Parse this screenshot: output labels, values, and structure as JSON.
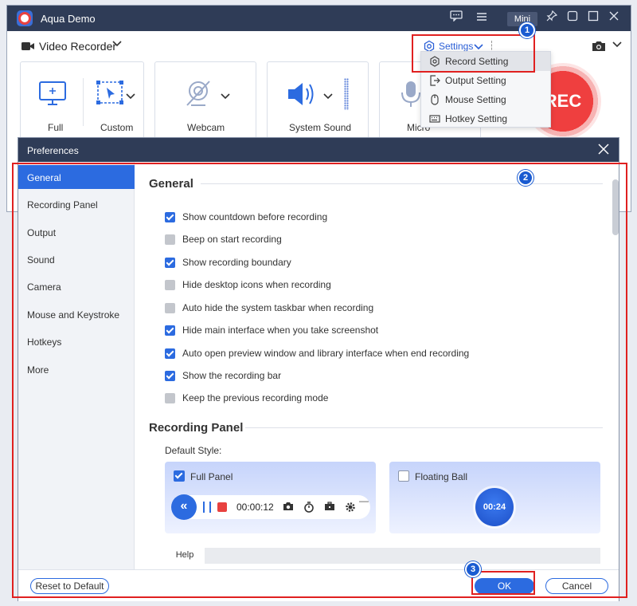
{
  "app": {
    "title": "Aqua Demo",
    "mini_label": "Mini",
    "mode_label": "Video Recorder",
    "settings_label": "Settings",
    "rec_label": "REC"
  },
  "panels": [
    {
      "label": "Full"
    },
    {
      "label": "Custom"
    },
    {
      "label": "Webcam"
    },
    {
      "label": "System Sound"
    },
    {
      "label": "Micro"
    }
  ],
  "settings_menu": [
    {
      "label": "Record Setting",
      "icon": "gear-icon",
      "highlighted": true
    },
    {
      "label": "Output Setting",
      "icon": "export-icon"
    },
    {
      "label": "Mouse Setting",
      "icon": "mouse-icon"
    },
    {
      "label": "Hotkey Setting",
      "icon": "keyboard-icon"
    }
  ],
  "badges": [
    "1",
    "2",
    "3"
  ],
  "prefs": {
    "title": "Preferences",
    "nav": [
      "General",
      "Recording Panel",
      "Output",
      "Sound",
      "Camera",
      "Mouse and Keystroke",
      "Hotkeys",
      "More"
    ],
    "active_nav": "General",
    "general_title": "General",
    "options": [
      {
        "label": "Show countdown before recording",
        "checked": true
      },
      {
        "label": "Beep on start recording",
        "checked": false
      },
      {
        "label": "Show recording boundary",
        "checked": true
      },
      {
        "label": "Hide desktop icons when recording",
        "checked": false
      },
      {
        "label": "Auto hide the system taskbar when recording",
        "checked": false
      },
      {
        "label": "Hide main interface when you take screenshot",
        "checked": true
      },
      {
        "label": "Auto open preview window and library interface when end recording",
        "checked": true
      },
      {
        "label": "Show the recording bar",
        "checked": true
      },
      {
        "label": "Keep the previous recording mode",
        "checked": false
      }
    ],
    "recording_panel_title": "Recording Panel",
    "default_style_label": "Default Style:",
    "styles": [
      {
        "label": "Full Panel",
        "checked": true,
        "time": "00:00:12",
        "minimize": "—"
      },
      {
        "label": "Floating Ball",
        "checked": false,
        "time": "00:24"
      }
    ],
    "help_tab": "Help",
    "buttons": {
      "reset": "Reset to Default",
      "ok": "OK",
      "cancel": "Cancel"
    }
  },
  "colors": {
    "accent": "#2c6be0",
    "titlebar": "#2f3c57",
    "rec": "#ef3f3f",
    "highlight_box": "#e02020",
    "badge": "#1a5bd1"
  }
}
